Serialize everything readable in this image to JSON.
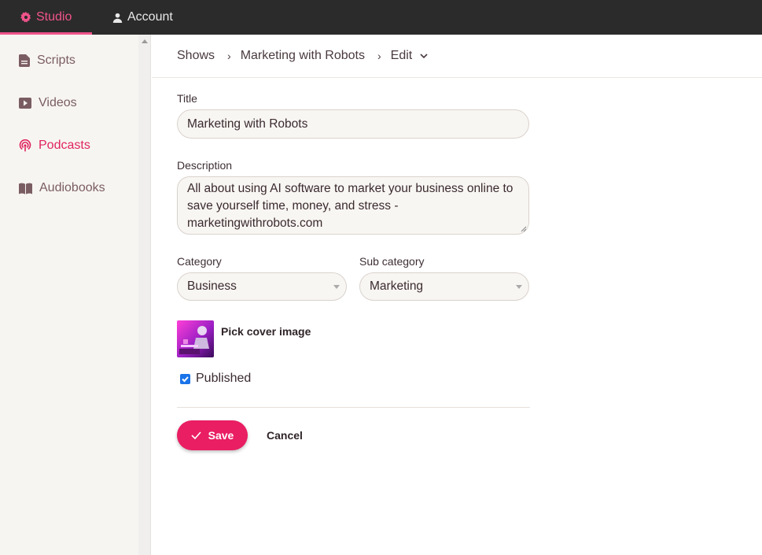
{
  "topnav": {
    "studio_label": "Studio",
    "account_label": "Account",
    "accent_color": "#f0548b"
  },
  "sidebar": {
    "items": [
      {
        "label": "Scripts",
        "icon": "document-icon"
      },
      {
        "label": "Videos",
        "icon": "play-icon"
      },
      {
        "label": "Podcasts",
        "icon": "podcast-icon",
        "active": true
      },
      {
        "label": "Audiobooks",
        "icon": "book-icon"
      }
    ]
  },
  "breadcrumb": {
    "items": [
      "Shows",
      "Marketing with Robots",
      "Edit"
    ]
  },
  "form": {
    "title_label": "Title",
    "title_value": "Marketing with Robots",
    "description_label": "Description",
    "description_value": "All about using AI software to market your business online to save yourself time, money, and stress - marketingwithrobots.com",
    "category_label": "Category",
    "category_value": "Business",
    "subcategory_label": "Sub category",
    "subcategory_value": "Marketing",
    "cover_label": "Pick cover image",
    "published_label": "Published",
    "published": true,
    "save_label": "Save",
    "cancel_label": "Cancel",
    "primary_color": "#e91e63"
  }
}
